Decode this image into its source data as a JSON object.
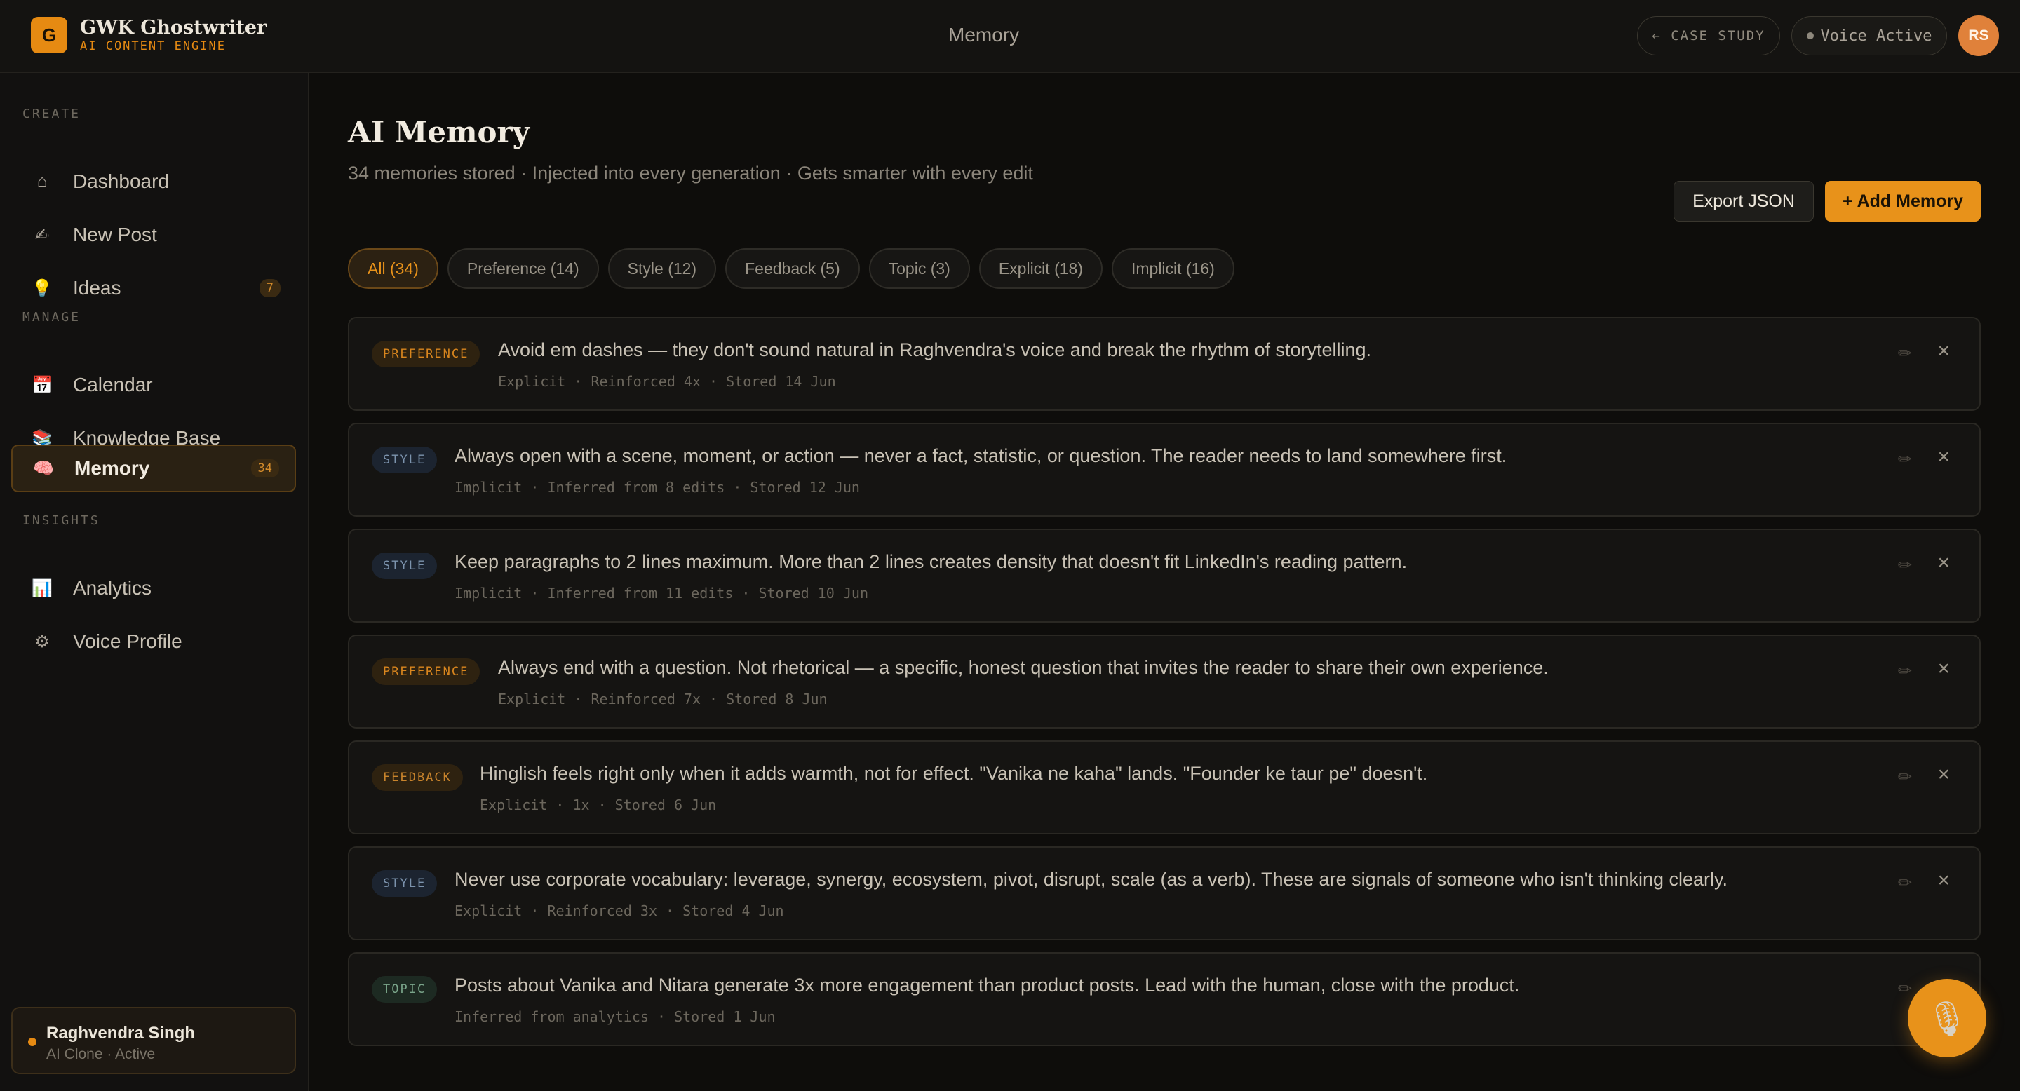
{
  "app": {
    "logo_letter": "G",
    "name": "GWK Ghostwriter",
    "tagline": "AI CONTENT ENGINE",
    "page_title": "Memory",
    "case_study": "← CASE STUDY",
    "voice_status": "Voice Active",
    "avatar_initials": "RS",
    "accent": "#e8921a"
  },
  "sidebar": {
    "sections": {
      "create": "CREATE",
      "manage": "MANAGE",
      "insights": "INSIGHTS"
    },
    "items": [
      {
        "label": "Dashboard",
        "icon": "home-icon",
        "glyph": "⌂"
      },
      {
        "label": "New Post",
        "icon": "writing-hand-icon",
        "glyph": "✍"
      },
      {
        "label": "Ideas",
        "icon": "lightbulb-icon",
        "glyph": "💡",
        "badge": "7"
      },
      {
        "label": "Calendar",
        "icon": "calendar-icon",
        "glyph": "📅"
      },
      {
        "label": "Knowledge Base",
        "icon": "books-icon",
        "glyph": "📚"
      },
      {
        "label": "Memory",
        "icon": "brain-icon",
        "glyph": "🧠",
        "badge": "34",
        "active": true
      },
      {
        "label": "Analytics",
        "icon": "bar-chart-icon",
        "glyph": "📊"
      },
      {
        "label": "Voice Profile",
        "icon": "gear-icon",
        "glyph": "⚙"
      }
    ],
    "user": {
      "name": "Raghvendra Singh",
      "status": "AI Clone · Active"
    }
  },
  "main": {
    "title": "AI Memory",
    "subtitle": "34 memories stored · Injected into every generation · Gets smarter with every edit",
    "export_label": "Export JSON",
    "add_label": "+ Add Memory",
    "filters": [
      {
        "label": "All (34)",
        "active": true
      },
      {
        "label": "Preference (14)"
      },
      {
        "label": "Style (12)"
      },
      {
        "label": "Feedback (5)"
      },
      {
        "label": "Topic (3)"
      },
      {
        "label": "Explicit (18)"
      },
      {
        "label": "Implicit (16)"
      }
    ],
    "memories": [
      {
        "tag": "PREFERENCE",
        "type": "preference",
        "text": "Avoid em dashes — they don't sound natural in Raghvendra's voice and break the rhythm of storytelling.",
        "meta": "Explicit · Reinforced 4x · Stored 14 Jun"
      },
      {
        "tag": "STYLE",
        "type": "style",
        "text": "Always open with a scene, moment, or action — never a fact, statistic, or question. The reader needs to land somewhere first.",
        "meta": "Implicit · Inferred from 8 edits · Stored 12 Jun"
      },
      {
        "tag": "STYLE",
        "type": "style",
        "text": "Keep paragraphs to 2 lines maximum. More than 2 lines creates density that doesn't fit LinkedIn's reading pattern.",
        "meta": "Implicit · Inferred from 11 edits · Stored 10 Jun"
      },
      {
        "tag": "PREFERENCE",
        "type": "preference",
        "text": "Always end with a question. Not rhetorical — a specific, honest question that invites the reader to share their own experience.",
        "meta": "Explicit · Reinforced 7x · Stored 8 Jun"
      },
      {
        "tag": "FEEDBACK",
        "type": "feedback",
        "text": "Hinglish feels right only when it adds warmth, not for effect. \"Vanika ne kaha\" lands. \"Founder ke taur pe\" doesn't.",
        "meta": "Explicit · 1x · Stored 6 Jun"
      },
      {
        "tag": "STYLE",
        "type": "style",
        "text": "Never use corporate vocabulary: leverage, synergy, ecosystem, pivot, disrupt, scale (as a verb). These are signals of someone who isn't thinking clearly.",
        "meta": "Explicit · Reinforced 3x · Stored 4 Jun"
      },
      {
        "tag": "TOPIC",
        "type": "topic",
        "text": "Posts about Vanika and Nitara generate 3x more engagement than product posts. Lead with the human, close with the product.",
        "meta": "Inferred from analytics · Stored 1 Jun"
      }
    ]
  }
}
